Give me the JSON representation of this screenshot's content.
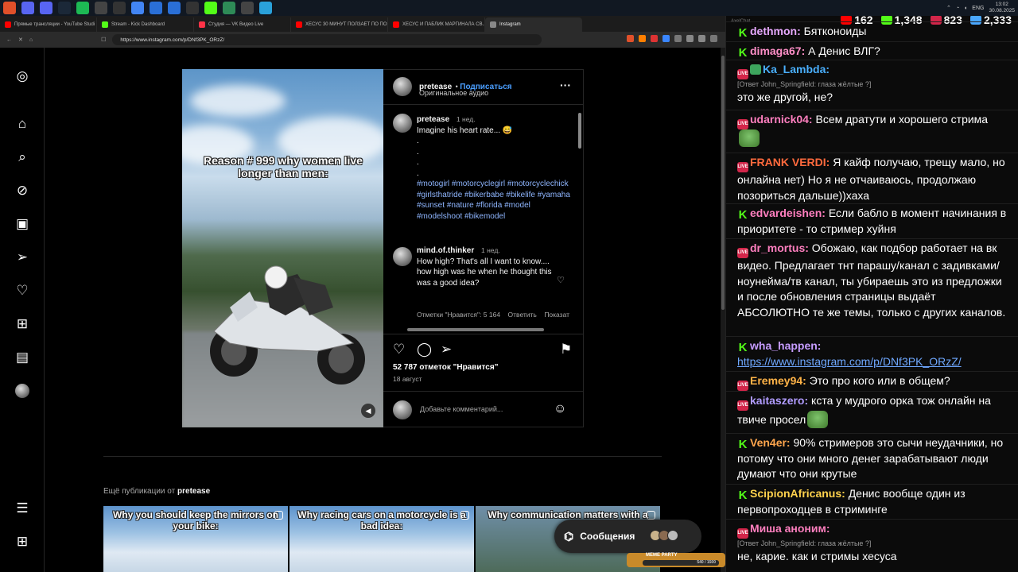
{
  "taskbar": {
    "icons": [
      {
        "name": "brave-icon",
        "color": "#e0502a"
      },
      {
        "name": "discord-icon",
        "color": "#5865f2"
      },
      {
        "name": "discord2-icon",
        "color": "#5865f2"
      },
      {
        "name": "steam-icon",
        "color": "#1b2838"
      },
      {
        "name": "spotify-icon",
        "color": "#1db954"
      },
      {
        "name": "app-icon",
        "color": "#444"
      },
      {
        "name": "app2-icon",
        "color": "#333"
      },
      {
        "name": "chrome-icon",
        "color": "#4285f4"
      },
      {
        "name": "app3-icon",
        "color": "#2a6fd6"
      },
      {
        "name": "app4-icon",
        "color": "#2a6fd6"
      },
      {
        "name": "obs-icon",
        "color": "#333"
      },
      {
        "name": "kick-icon",
        "color": "#53fc18"
      },
      {
        "name": "app5-icon",
        "color": "#2e8b57"
      },
      {
        "name": "app6-icon",
        "color": "#444"
      },
      {
        "name": "telegram-icon",
        "color": "#2aa1da"
      }
    ],
    "lang": "ENG",
    "time": "13:02",
    "date": "30.08.2025"
  },
  "browser": {
    "tabs": [
      {
        "label": "Прямые трансляции - YouTube Studi",
        "color": "#ff0000"
      },
      {
        "label": "Stream - Kick Dashboard",
        "color": "#53fc18"
      },
      {
        "label": "Студия — VK Видео Live",
        "color": "#ff3347"
      },
      {
        "label": "ХЕСУС 30 МИНУТ ПОЛЗАЕТ ПО ПО...",
        "color": "#ff0000"
      },
      {
        "label": "ХЕСУС И ПАБЛИК МАРГИНАЛА СВ...",
        "color": "#ff0000"
      },
      {
        "label": "Instagram",
        "color": "#888"
      }
    ],
    "url": "https://www.instagram.com/p/DNf3PK_ORzZ/"
  },
  "instagram": {
    "video_text": "Reason # 999 why women live longer than men:",
    "author": "pretease",
    "follow": "Подписаться",
    "audio": "Оригинальное аудио",
    "caption_author": "pretease",
    "caption_time": "1 нед.",
    "caption_text": "Imagine his heart rate... 😅",
    "dots": [
      ".",
      ".",
      ".",
      "."
    ],
    "hashtags": "#motogirl #motorcyclegirl #motorcyclechick #girlsthatride #bikerbabe #bikelife #yamaha #sunset #nature #florida #model #modelshoot #bikemodel",
    "comment_author": "mind.of.thinker",
    "comment_time": "1 нед.",
    "comment_text": "How high? That's all I want to know.... how high was he when he thought this was a good idea?",
    "comment_likes": "Отметки \"Нравится\": 5 164",
    "comment_reply": "Ответить",
    "comment_show": "Показат",
    "likes": "52 787 отметок \"Нравится\"",
    "date": "18 август",
    "add_comment": "Добавьте комментарий...",
    "more_label": "Ещё публикации от",
    "more_author": "pretease",
    "thumbs": [
      "Why you should keep the mirrors on your bike:",
      "Why racing cars on a motorcycle is a bad idea:",
      "Why communication matters with a"
    ],
    "messages": "Сообщения",
    "meme_badge": "MEME PARTY",
    "meme_progress": "540 / 1500"
  },
  "chat": {
    "app": "AxelChat",
    "stats": [
      {
        "name": "youtube",
        "value": "162",
        "color": "#ff0000"
      },
      {
        "name": "kick",
        "value": "1,348",
        "color": "#53fc18"
      },
      {
        "name": "vk",
        "value": "823",
        "color": "#d3264a"
      },
      {
        "name": "viewers",
        "value": "2,333",
        "color": "#4aa8ff"
      }
    ],
    "messages": [
      {
        "badge": "k",
        "nick": "dethmon:",
        "color": "#e7a9ff",
        "text": "Бятконоиды"
      },
      {
        "badge": "k",
        "nick": "dimaga67:",
        "color": "#ff8fc8",
        "text": "А Денис ВЛГ?"
      },
      {
        "badge": "live",
        "badge2": "sh",
        "nick": "Ka_Lambda:",
        "color": "#4ab0ff",
        "reply": "[Ответ John_Springfield: глаза жёлтые ?]",
        "text": "это же другой, не?"
      },
      {
        "badge": "live",
        "nick": "udarnick04:",
        "color": "#ff7fbf",
        "text": "Всем дратути и хорошего стрима"
      },
      {
        "badge": "live",
        "nick": "FRANK VERDI:",
        "color": "#ff6a3d",
        "text": "Я кайф получаю, трещу мало, но онлайна нет) Но я не отчаиваюсь, продолжаю позориться дальше))хаха"
      },
      {
        "badge": "k",
        "nick": "edvardeishen:",
        "color": "#ff7fbf",
        "text": "Если бабло в момент начинания в приоритете - то стример хуйня"
      },
      {
        "badge": "live",
        "nick": "dr_mortus:",
        "color": "#ff7fbf",
        "text": "Обожаю, как подбор работает на вк видео. Предлагает тнт парашу/канал с задивками/ноунейма/тв канал, ты убираешь это из предложки и после обновления страницы выдаёт АБСОЛЮТНО те же темы, только с других каналов."
      },
      {
        "badge": "k",
        "nick": "wha_happen:",
        "color": "#c69cff",
        "link": "https://www.instagram.com/p/DNf3PK_ORzZ/"
      },
      {
        "badge": "live",
        "nick": "Eremey94:",
        "color": "#ffb347",
        "text": "Это про кого или в общем?"
      },
      {
        "badge": "live",
        "nick": "kaitaszero:",
        "color": "#b19cff",
        "text": "кста у мудрого орка тож онлайн на твиче просел"
      },
      {
        "badge": "k",
        "nick": "Ven4er:",
        "color": "#ffa64d",
        "text": "90% стримеров это сычи неудачники, но потому что они много денег зарабатывают люди думают что они крутые"
      },
      {
        "badge": "k",
        "nick": "ScipionAfricanus:",
        "color": "#ffd24d",
        "text": "Денис вообще один из первопроходцев в стриминге"
      },
      {
        "badge": "live",
        "nick": "Миша аноним:",
        "color": "#ff7fbf",
        "reply": "[Ответ John_Springfield: глаза жёлтые ?]",
        "text": "не, карие. как и стримы хесуса"
      }
    ]
  }
}
